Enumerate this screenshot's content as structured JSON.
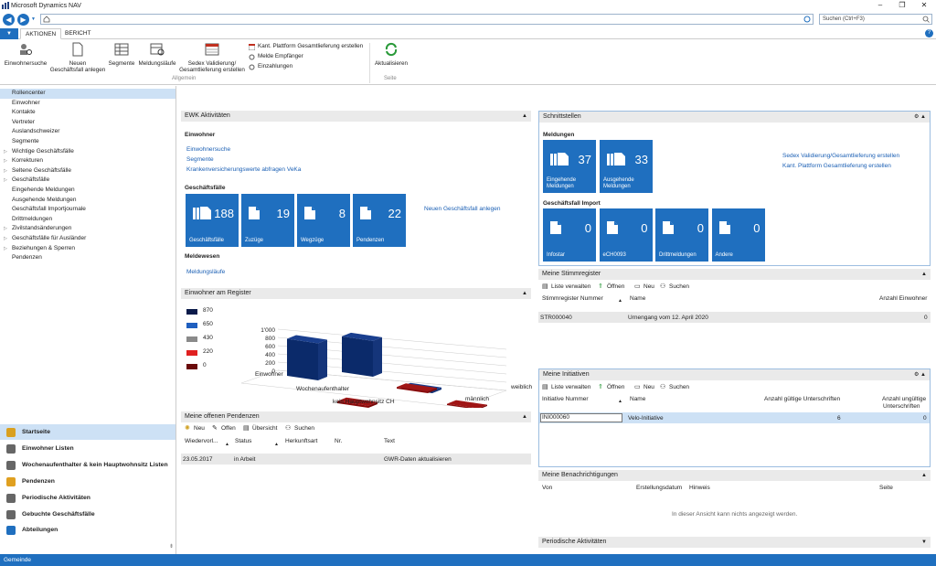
{
  "window": {
    "title": "Microsoft Dynamics NAV"
  },
  "address": {
    "value": "",
    "search_placeholder": "Suchen (Ctrl+F3)"
  },
  "tabs": [
    {
      "label": "AKTIONEN"
    },
    {
      "label": "BERICHT"
    }
  ],
  "ribbon": {
    "einwohnersuche": "Einwohnersuche",
    "neuer_line1": "Neuen",
    "neuer_line2": "Geschäftsfall anlegen",
    "segmente": "Segmente",
    "meldungslaeufe": "Meldungsläufe",
    "sedex_line1": "Sedex Validierung/",
    "sedex_line2": "Gesamtlieferung erstellen",
    "kant": "Kant. Plattform Gesamtlieferung erstellen",
    "melde": "Melde Empfänger",
    "zahlungen": "Einzahlungen",
    "aktualisieren": "Aktualisieren",
    "group_allgemein": "Allgemein",
    "group_seite": "Seite"
  },
  "nav": {
    "items": [
      {
        "label": "Rollencenter",
        "arrow": ""
      },
      {
        "label": "Einwohner",
        "arrow": ""
      },
      {
        "label": "Kontakte",
        "arrow": ""
      },
      {
        "label": "Vertreter",
        "arrow": ""
      },
      {
        "label": "Auslandschweizer",
        "arrow": ""
      },
      {
        "label": "Segmente",
        "arrow": ""
      },
      {
        "label": "Wichtige Geschäftsfälle",
        "arrow": "▷"
      },
      {
        "label": "Korrekturen",
        "arrow": "▷"
      },
      {
        "label": "Seltene Geschäftsfälle",
        "arrow": "▷"
      },
      {
        "label": "Geschäftsfälle",
        "arrow": "▷"
      },
      {
        "label": "Eingehende Meldungen",
        "arrow": ""
      },
      {
        "label": "Ausgehende Meldungen",
        "arrow": ""
      },
      {
        "label": "Geschäftsfall Importjournale",
        "arrow": ""
      },
      {
        "label": "Drittmeldungen",
        "arrow": ""
      },
      {
        "label": "Zivilstandsänderungen",
        "arrow": "▷"
      },
      {
        "label": "Geschäftsfälle für Ausländer",
        "arrow": "▷"
      },
      {
        "label": "Beziehungen & Sperren",
        "arrow": "▷"
      },
      {
        "label": "Pendenzen",
        "arrow": ""
      }
    ],
    "bottom": [
      {
        "label": "Startseite"
      },
      {
        "label": "Einwohner Listen"
      },
      {
        "label": "Wochenaufenthalter & kein Hauptwohnsitz Listen"
      },
      {
        "label": "Pendenzen"
      },
      {
        "label": "Periodische Aktivitäten"
      },
      {
        "label": "Gebuchte Geschäftsfälle"
      },
      {
        "label": "Abteilungen"
      }
    ]
  },
  "ewk": {
    "title": "EWK Aktivitäten",
    "einwohner_label": "Einwohner",
    "links": [
      "Einwohnersuche",
      "Segmente",
      "Krankenversicherungswerte abfragen VeKa"
    ],
    "gf_label": "Geschäftsfälle",
    "tiles": [
      {
        "label": "Geschäftsfälle",
        "value": "188"
      },
      {
        "label": "Zuzüge",
        "value": "19"
      },
      {
        "label": "Wegzüge",
        "value": "8"
      },
      {
        "label": "Pendenzen",
        "value": "22"
      }
    ],
    "neuer_link": "Neuen Geschäftsfall anlegen",
    "meldewesen_label": "Meldewesen",
    "meldungslaeufe": "Meldungsläufe"
  },
  "register": {
    "title": "Einwohner am Register",
    "legend": [
      {
        "value": "870",
        "color": "#0a1a4a"
      },
      {
        "value": "650",
        "color": "#1f5fbf"
      },
      {
        "value": "430",
        "color": "#8a8a8a"
      },
      {
        "value": "220",
        "color": "#e02020"
      },
      {
        "value": "0",
        "color": "#6a0a0a"
      }
    ]
  },
  "chart_data": {
    "type": "bar",
    "categories": [
      "Einwohner",
      "Wochenaufenthalter",
      "kein Hauptwohnsitz CH"
    ],
    "series_labels": [
      "weiblich",
      "männlich"
    ],
    "ylim": [
      0,
      1000
    ],
    "yticks": [
      "1'000",
      "800",
      "600",
      "400",
      "200",
      "0"
    ],
    "series": [
      {
        "values": [
          900,
          870,
          50
        ]
      },
      {
        "values": [
          50,
          40,
          30
        ]
      }
    ]
  },
  "pendenzen": {
    "title": "Meine offenen Pendenzen",
    "toolbar": [
      "Neu",
      "Offen",
      "Übersicht",
      "Suchen"
    ],
    "columns": [
      "Wiedervorl...",
      "Status",
      "Herkunftsart",
      "Nr.",
      "Text"
    ],
    "row": {
      "date": "23.05.2017",
      "status": "in Arbeit",
      "text": "GWR-Daten aktualisieren"
    }
  },
  "schnitt": {
    "title": "Schnittstellen",
    "meldungen_label": "Meldungen",
    "tiles1": [
      {
        "label1": "Eingehende",
        "label2": "Meldungen",
        "value": "37"
      },
      {
        "label1": "Ausgehende",
        "label2": "Meldungen",
        "value": "33"
      }
    ],
    "links": [
      "Sedex Validierung/Gesamtlieferung erstellen",
      "Kant. Plattform Gesamtlieferung erstellen"
    ],
    "import_label": "Geschäftsfall Import",
    "tiles2": [
      {
        "label": "Infostar",
        "value": "0"
      },
      {
        "label": "eCH0093",
        "value": "0"
      },
      {
        "label": "Drittmeldungen",
        "value": "0"
      },
      {
        "label": "Andere",
        "value": "0"
      }
    ]
  },
  "stimm": {
    "title": "Meine Stimmregister",
    "toolbar": [
      "Liste verwalten",
      "Öffnen",
      "Neu",
      "Suchen"
    ],
    "columns": [
      "Stimmregister Nummer",
      "Name",
      "Anzahl Einwohner"
    ],
    "row": {
      "nr": "STR000040",
      "name": "Urnengang vom 12. April 2020",
      "anzahl": "0"
    }
  },
  "init": {
    "title": "Meine Initiativen",
    "toolbar": [
      "Liste verwalten",
      "Öffnen",
      "Neu",
      "Suchen"
    ],
    "columns": [
      "Initiative Nummer",
      "Name",
      "Anzahl gültige Unterschriften",
      "Anzahl ungültige",
      "Unterschriften"
    ],
    "row": {
      "nr": "INI000060",
      "name": "Velo-Initiative",
      "g": "6",
      "u": "0"
    }
  },
  "benach": {
    "title": "Meine Benachrichtigungen",
    "columns": [
      "Von",
      "Erstellungsdatum",
      "Hinweis",
      "Seite"
    ],
    "empty": "In dieser Ansicht kann nichts angezeigt werden."
  },
  "periodisch": {
    "title": "Periodische Aktivitäten"
  },
  "status": {
    "text": "Gemeinde"
  }
}
